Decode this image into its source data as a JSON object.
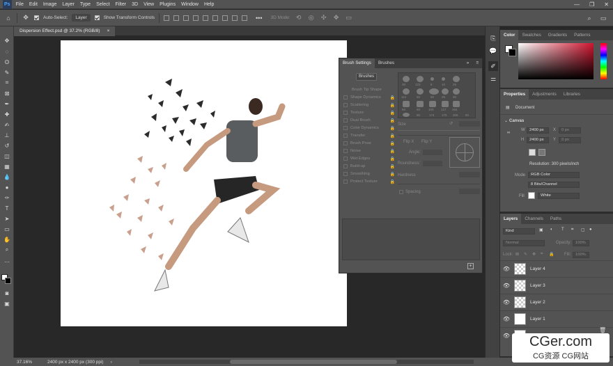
{
  "menu": [
    "File",
    "Edit",
    "Image",
    "Layer",
    "Type",
    "Select",
    "Filter",
    "3D",
    "View",
    "Plugins",
    "Window",
    "Help"
  ],
  "options": {
    "auto_select_label": "Auto-Select:",
    "auto_select_value": "Layer",
    "transform_label": "Show Transform Controls",
    "mode_3d": "3D Mode:"
  },
  "document_tab": {
    "title": "Dispersion Effect.psd @ 37.2% (RGB/8)",
    "close": "×"
  },
  "status": {
    "zoom": "37.16%",
    "info": "2400 px x 2400 px (300 ppi)"
  },
  "brush_panel": {
    "tabs": [
      "Brush Settings",
      "Brushes"
    ],
    "brushes_button": "Brushes",
    "options": [
      "Brush Tip Shape",
      "Shape Dynamics",
      "Scattering",
      "Texture",
      "Dual Brush",
      "Color Dynamics",
      "Transfer",
      "Brush Pose",
      "Noise",
      "Wet Edges",
      "Build-up",
      "Smoothing",
      "Protect Texture"
    ],
    "tip_sizes": [
      "30",
      "123",
      "8",
      "10",
      "25",
      "112",
      "60",
      "50",
      "25",
      "30",
      "50",
      "60",
      "100",
      "127",
      "284",
      "80",
      "174",
      "175",
      "306",
      "50"
    ],
    "size_label": "Size",
    "flip_x": "Flip X",
    "flip_y": "Flip Y",
    "angle": "Angle:",
    "roundness": "Roundness:",
    "hardness": "Hardness",
    "spacing": "Spacing"
  },
  "color_panel": {
    "tabs": [
      "Color",
      "Swatches",
      "Gradients",
      "Patterns"
    ]
  },
  "properties_panel": {
    "tabs": [
      "Properties",
      "Adjustments",
      "Libraries"
    ],
    "document_label": "Document",
    "canvas_label": "Canvas",
    "w_label": "W",
    "w_value": "2400 px",
    "x_label": "X",
    "x_value": "0 px",
    "h_label": "H",
    "h_value": "2400 px",
    "y_label": "Y",
    "y_value": "0 px",
    "resolution": "Resolution: 300 pixels/inch",
    "mode_label": "Mode",
    "mode_value": "RGB Color",
    "depth_value": "8 Bits/Channel",
    "fill_label": "Fill",
    "fill_value": "White"
  },
  "layers_panel": {
    "tabs": [
      "Layers",
      "Channels",
      "Paths"
    ],
    "kind": "Kind",
    "blend": "Normal",
    "opacity_label": "Opacity:",
    "opacity_value": "100%",
    "lock_label": "Lock:",
    "fill_label": "Fill:",
    "fill_value": "100%",
    "layers": [
      "Layer 4",
      "Layer 3",
      "Layer 2",
      "Layer 1"
    ]
  },
  "watermark": {
    "main": "CGer.com",
    "sub": "CG资源 CG网站"
  }
}
